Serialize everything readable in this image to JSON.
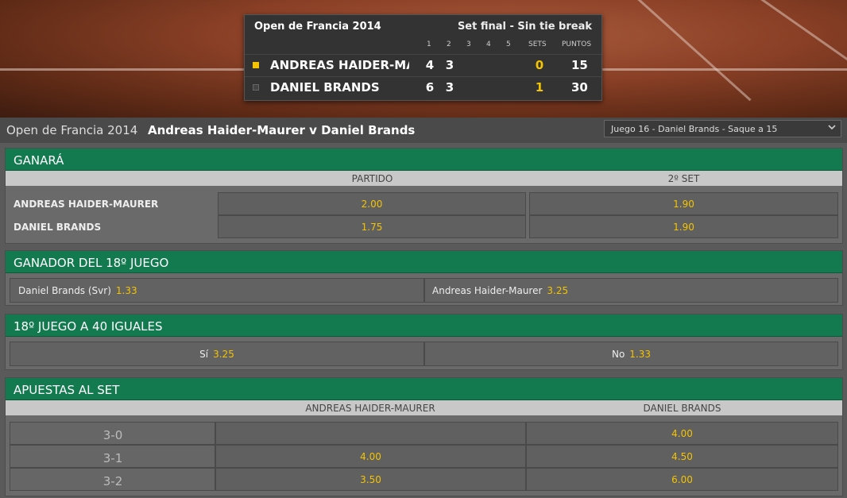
{
  "scoreboard": {
    "competition": "Open de Francia 2014",
    "format": "Set final - Sin tie break",
    "columns": [
      "1",
      "2",
      "3",
      "4",
      "5",
      "SETS",
      "PUNTOS"
    ],
    "players": [
      {
        "name": "ANDREAS HAIDER-MA...",
        "serving": true,
        "set1": "4",
        "set2": "3",
        "sets": "0",
        "points": "15"
      },
      {
        "name": "DANIEL BRANDS",
        "serving": false,
        "set1": "6",
        "set2": "3",
        "sets": "1",
        "points": "30"
      }
    ]
  },
  "header": {
    "competition": "Open de Francia 2014",
    "match": "Andreas Haider-Maurer v Daniel Brands",
    "select_value": "Juego 16 - Daniel Brands - Saque a 15"
  },
  "ganara": {
    "title": "GANARÁ",
    "col1": "PARTIDO",
    "col2": "2º SET",
    "rows": [
      {
        "player": "ANDREAS HAIDER-MAURER",
        "match": "2.00",
        "set": "1.90"
      },
      {
        "player": "DANIEL BRANDS",
        "match": "1.75",
        "set": "1.90"
      }
    ]
  },
  "game_winner": {
    "title": "GANADOR DEL 18º  JUEGO",
    "left_label": "Daniel Brands (Svr)",
    "left_odds": "1.33",
    "right_label": "Andreas Haider-Maurer",
    "right_odds": "3.25"
  },
  "deuce": {
    "title": "18º  JUEGO A 40 IGUALES",
    "yes_label": "Sí",
    "yes_odds": "3.25",
    "no_label": "No",
    "no_odds": "1.33"
  },
  "set_betting": {
    "title": "APUESTAS AL SET",
    "col1": "ANDREAS HAIDER-MAURER",
    "col2": "DANIEL BRANDS",
    "rows": [
      {
        "score": "3-0",
        "p1": "",
        "p2": "4.00"
      },
      {
        "score": "3-1",
        "p1": "4.00",
        "p2": "4.50"
      },
      {
        "score": "3-2",
        "p1": "3.50",
        "p2": "6.00"
      }
    ]
  },
  "colors": {
    "accent_green": "#127a4e",
    "odds_yellow": "#f4c400"
  }
}
